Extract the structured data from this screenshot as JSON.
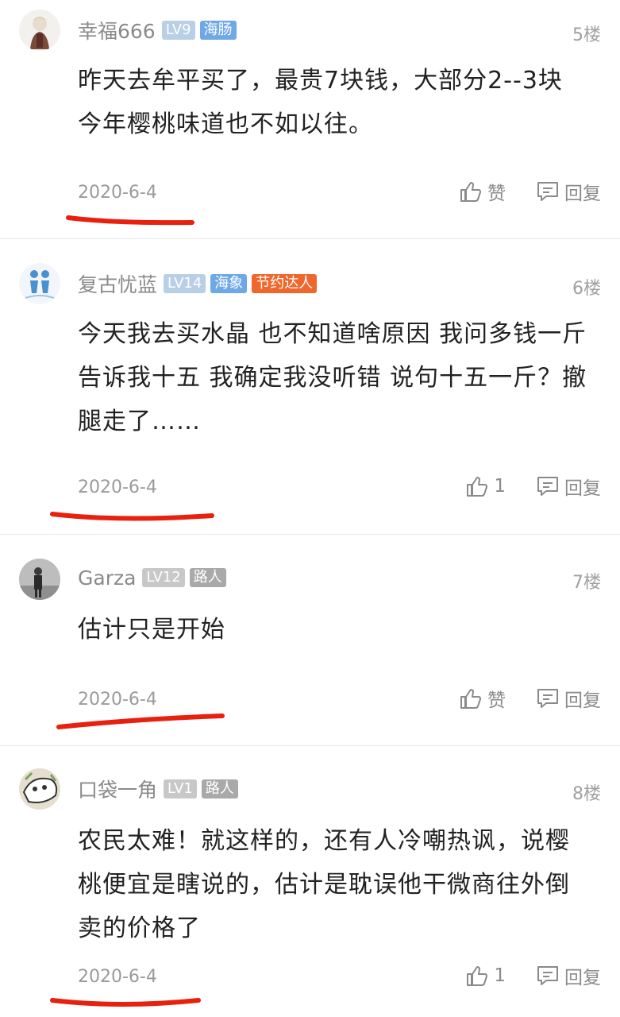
{
  "comments": [
    {
      "username": "幸福666",
      "badges": [
        "LV9",
        "海肠"
      ],
      "floor": "5楼",
      "content": "昨天去牟平买了，最贵7块钱，大部分2--3块  今年樱桃味道也不如以往。",
      "date": "2020-6-4",
      "like": "赞",
      "reply": "回复"
    },
    {
      "username": "复古忧蓝",
      "badges": [
        "LV14",
        "海象",
        "节约达人"
      ],
      "floor": "6楼",
      "content": "今天我去买水晶 也不知道啥原因 我问多钱一斤 告诉我十五 我确定我没听错 说句十五一斤？撤腿走了……",
      "date": "2020-6-4",
      "like": "1",
      "reply": "回复"
    },
    {
      "username": "Garza",
      "badges": [
        "LV12",
        "路人"
      ],
      "floor": "7楼",
      "content": "估计只是开始",
      "date": "2020-6-4",
      "like": "赞",
      "reply": "回复"
    },
    {
      "username": "口袋一角",
      "badges": [
        "LV1",
        "路人"
      ],
      "floor": "8楼",
      "content": "农民太难！就这样的，还有人冷嘲热讽，说樱桃便宜是瞎说的，估计是耽误他干微商往外倒卖的价格了",
      "date": "2020-6-4",
      "like": "1",
      "reply": "回复"
    }
  ],
  "colors": {
    "underline": "#e8210f",
    "meta": "#8a8a8a",
    "text": "#222222"
  },
  "icons": [
    "thumbs-up-icon",
    "reply-icon"
  ]
}
